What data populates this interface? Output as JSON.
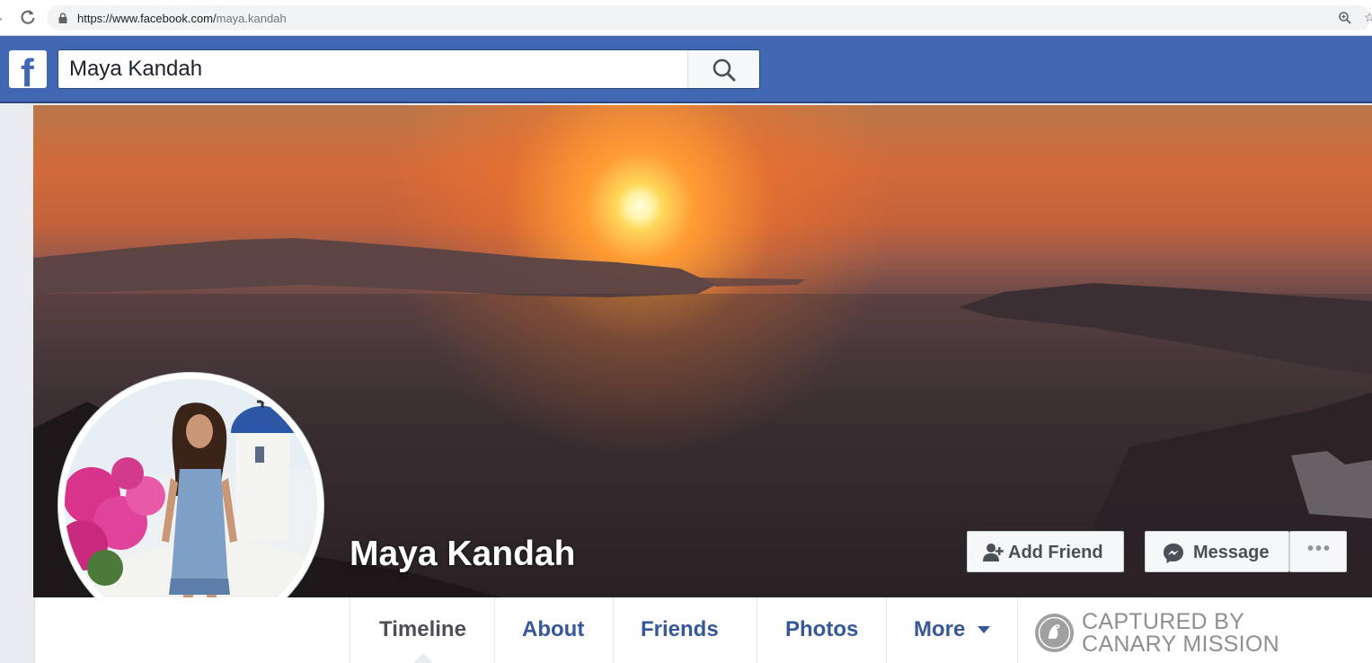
{
  "browser": {
    "url_domain": "https://www.facebook.com/",
    "url_path": "maya.kandah"
  },
  "fb": {
    "logo_letter": "f",
    "search_value": "Maya Kandah"
  },
  "profile": {
    "name": "Maya Kandah"
  },
  "actions": {
    "add_friend": "Add Friend",
    "message": "Message",
    "more_dots": "•••"
  },
  "nav": {
    "tabs": [
      {
        "label": "Timeline"
      },
      {
        "label": "About"
      },
      {
        "label": "Friends"
      },
      {
        "label": "Photos"
      },
      {
        "label": "More"
      }
    ]
  },
  "watermark": {
    "line1": "CAPTURED BY",
    "line2": "CANARY MISSION"
  },
  "colors": {
    "fb_blue": "#4267b2",
    "link_blue": "#365899"
  }
}
